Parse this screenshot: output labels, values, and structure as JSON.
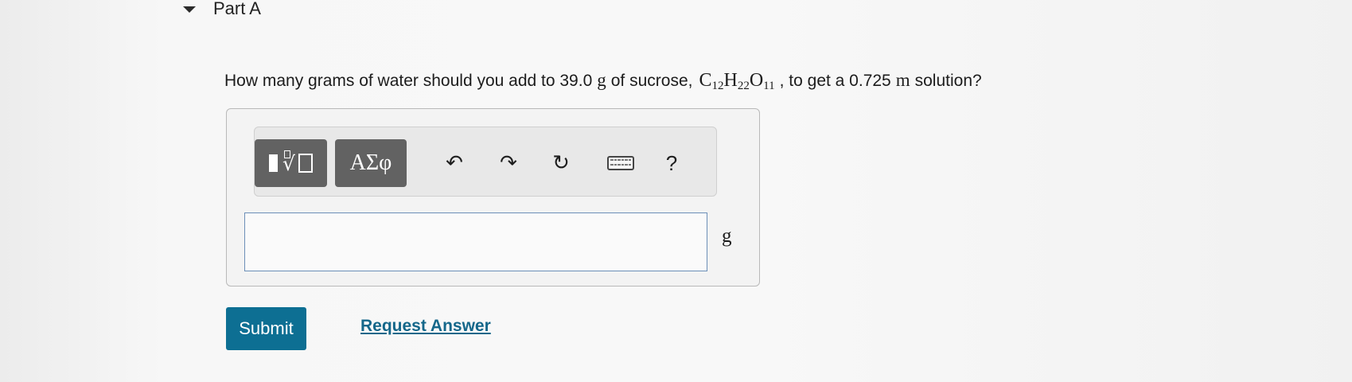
{
  "part": {
    "title": "Part A"
  },
  "question": {
    "text_before": "How many grams of water should you add to 39.0",
    "mass_unit": "g",
    "text_mid": "of sucrose,",
    "formula": {
      "c": "C",
      "c_sub": "12",
      "h": "H",
      "h_sub": "22",
      "o": "O",
      "o_sub": "11"
    },
    "text_after": ", to get a 0.725",
    "molality_unit": "m",
    "text_end": "solution?"
  },
  "toolbar": {
    "symbols_label": "ΑΣφ",
    "undo_glyph": "↶",
    "redo_glyph": "↷",
    "reset_glyph": "↻",
    "help_label": "?"
  },
  "answer": {
    "value": "",
    "unit": "g"
  },
  "actions": {
    "submit_label": "Submit",
    "request_answer_label": "Request Answer"
  },
  "colors": {
    "submit_bg": "#0d6f93",
    "link": "#14678a",
    "toolbar_button": "#626262"
  }
}
